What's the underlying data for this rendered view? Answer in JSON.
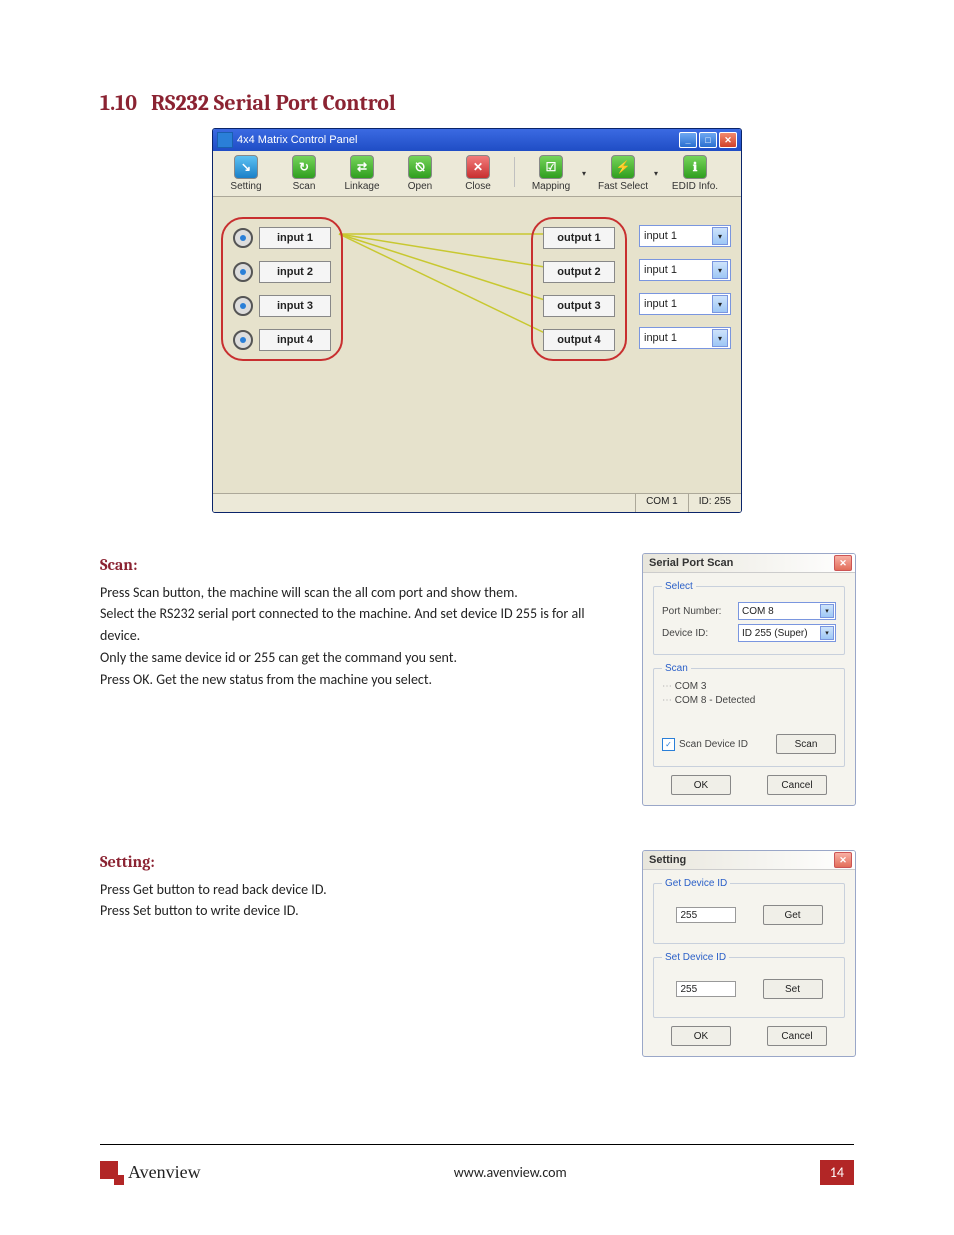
{
  "heading": {
    "number": "1.10",
    "title": "RS232 Serial Port Control"
  },
  "matrix_window": {
    "title": "4x4 Matrix Control Panel",
    "toolbar": [
      {
        "label": "Setting",
        "color": "ic-blue",
        "glyph": "↘"
      },
      {
        "label": "Scan",
        "color": "ic-green",
        "glyph": "↻"
      },
      {
        "label": "Linkage",
        "color": "ic-green",
        "glyph": "⇄"
      },
      {
        "label": "Open",
        "color": "ic-green",
        "glyph": "⦰"
      },
      {
        "label": "Close",
        "color": "ic-red",
        "glyph": "✕"
      }
    ],
    "toolbar2": [
      {
        "label": "Mapping",
        "color": "ic-green",
        "glyph": "☑",
        "dropdown": true
      },
      {
        "label": "Fast Select",
        "color": "ic-green",
        "glyph": "⚡",
        "dropdown": true
      },
      {
        "label": "EDID Info.",
        "color": "ic-green",
        "glyph": "ℹ"
      }
    ],
    "inputs": [
      "input 1",
      "input 2",
      "input 3",
      "input 4"
    ],
    "outputs": [
      "output 1",
      "output 2",
      "output 3",
      "output 4"
    ],
    "out_selects": [
      "input 1",
      "input 1",
      "input 1",
      "input 1"
    ],
    "status_port": "COM 1",
    "status_id": "ID: 255"
  },
  "scan_section": {
    "heading": "Scan:",
    "p1": "Press Scan button, the machine will scan the all com port and show them.",
    "p2": "Select the RS232 serial port connected to the machine. And set device ID 255 is for all device.",
    "p3": "Only the same device id or 255 can get the command you sent.",
    "p4": "Press OK. Get the new status from the machine you select."
  },
  "scan_dialog": {
    "title": "Serial Port Scan",
    "select_legend": "Select",
    "port_label": "Port Number:",
    "port_value": "COM 8",
    "device_label": "Device ID:",
    "device_value": "ID 255 (Super)",
    "scan_legend": "Scan",
    "tree_item1": "COM 3",
    "tree_item2": "COM 8 - Detected",
    "scan_device_label": "Scan Device ID",
    "scan_btn": "Scan",
    "ok": "OK",
    "cancel": "Cancel"
  },
  "setting_section": {
    "heading": "Setting:",
    "p1": "Press Get button to read back device ID.",
    "p2": "Press Set button to write device ID."
  },
  "setting_dialog": {
    "title": "Setting",
    "get_legend": "Get Device ID",
    "get_value": "255",
    "get_btn": "Get",
    "set_legend": "Set Device ID",
    "set_value": "255",
    "set_btn": "Set",
    "ok": "OK",
    "cancel": "Cancel"
  },
  "footer": {
    "brand": "Avenview",
    "url": "www.avenview.com",
    "page": "14"
  }
}
